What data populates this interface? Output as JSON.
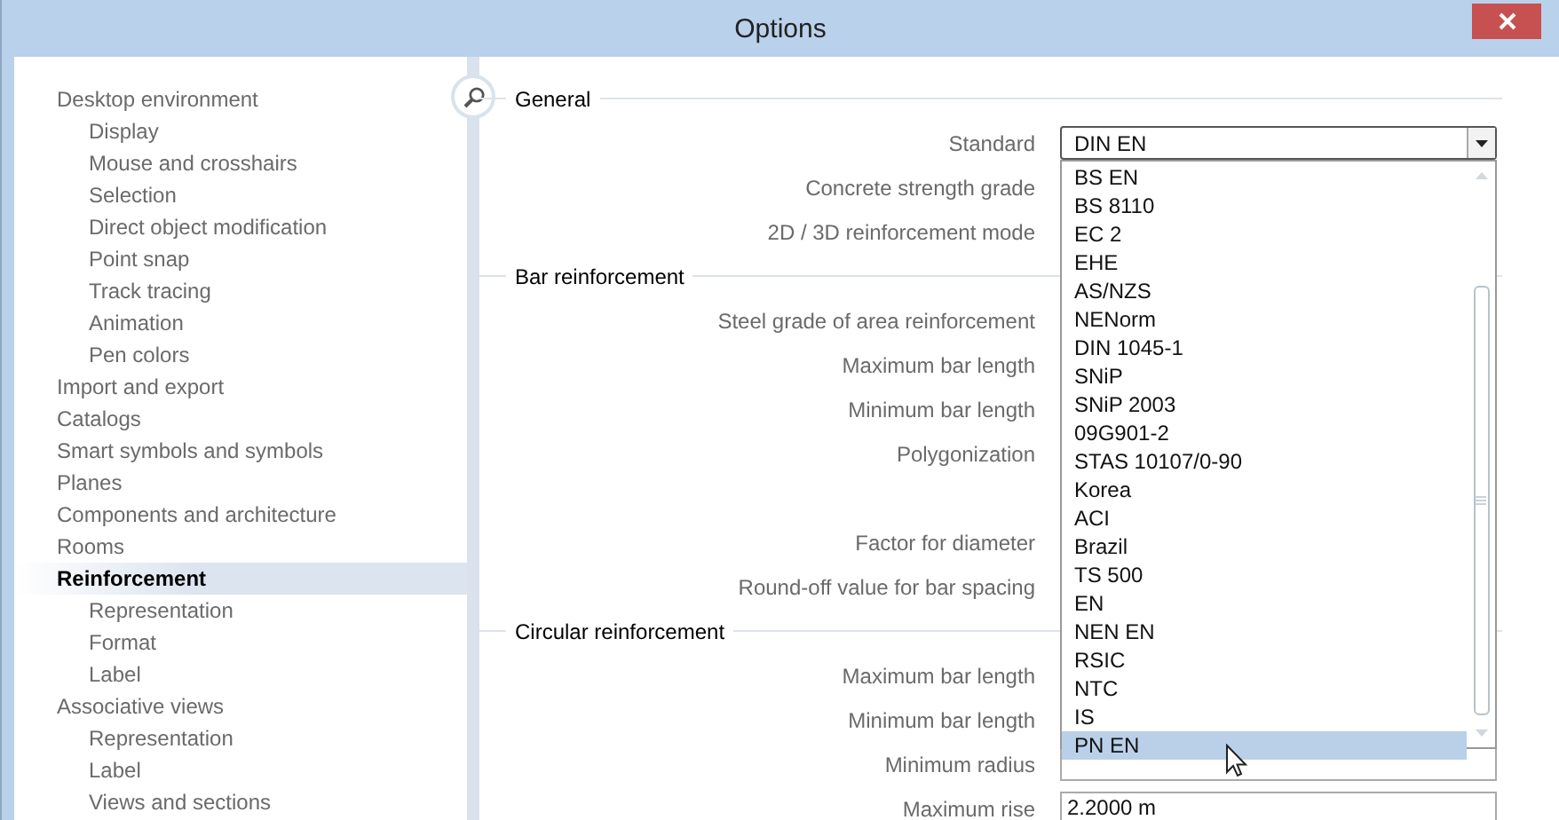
{
  "window": {
    "title": "Options"
  },
  "nav": [
    {
      "label": "Desktop environment",
      "selected": false,
      "children": [
        {
          "label": "Display",
          "selected": false
        },
        {
          "label": "Mouse and crosshairs",
          "selected": false
        },
        {
          "label": "Selection",
          "selected": false
        },
        {
          "label": "Direct object modification",
          "selected": false
        },
        {
          "label": "Point snap",
          "selected": false
        },
        {
          "label": "Track tracing",
          "selected": false
        },
        {
          "label": "Animation",
          "selected": false
        },
        {
          "label": "Pen colors",
          "selected": false
        }
      ]
    },
    {
      "label": "Import and export",
      "selected": false
    },
    {
      "label": "Catalogs",
      "selected": false
    },
    {
      "label": "Smart symbols and symbols",
      "selected": false
    },
    {
      "label": "Planes",
      "selected": false
    },
    {
      "label": "Components and architecture",
      "selected": false
    },
    {
      "label": "Rooms",
      "selected": false
    },
    {
      "label": "Reinforcement",
      "selected": true,
      "children": [
        {
          "label": "Representation",
          "selected": false
        },
        {
          "label": "Format",
          "selected": false
        },
        {
          "label": "Label",
          "selected": false
        }
      ]
    },
    {
      "label": "Associative views",
      "selected": false,
      "children": [
        {
          "label": "Representation",
          "selected": false
        },
        {
          "label": "Label",
          "selected": false
        },
        {
          "label": "Views and sections",
          "selected": false
        }
      ]
    }
  ],
  "sections": [
    {
      "title": "General",
      "rows": [
        {
          "kind": "combo",
          "label": "Standard",
          "value": "DIN EN",
          "expanded": true
        },
        {
          "kind": "plain",
          "label": "Concrete strength grade"
        },
        {
          "kind": "plain",
          "label": "2D / 3D reinforcement mode"
        }
      ]
    },
    {
      "title": "Bar reinforcement",
      "rows": [
        {
          "kind": "plain",
          "label": "Steel grade of area reinforcement"
        },
        {
          "kind": "plain",
          "label": "Maximum bar length"
        },
        {
          "kind": "plain",
          "label": "Minimum bar length"
        },
        {
          "kind": "plain",
          "label": "Polygonization"
        },
        {
          "kind": "blank"
        },
        {
          "kind": "plain",
          "label": "Factor for diameter"
        },
        {
          "kind": "plain",
          "label": "Round-off value for bar spacing"
        }
      ]
    },
    {
      "title": "Circular reinforcement",
      "rows": [
        {
          "kind": "plain",
          "label": "Maximum bar length"
        },
        {
          "kind": "plain",
          "label": "Minimum bar length"
        },
        {
          "kind": "field",
          "label": "Minimum radius"
        },
        {
          "kind": "field",
          "label": "Maximum rise",
          "value": "2.2000 m"
        }
      ]
    }
  ],
  "dropdown": {
    "items": [
      {
        "label": "BS EN",
        "selected": false
      },
      {
        "label": "BS 8110",
        "selected": false
      },
      {
        "label": "EC 2",
        "selected": false
      },
      {
        "label": "EHE",
        "selected": false
      },
      {
        "label": "AS/NZS",
        "selected": false
      },
      {
        "label": "NENorm",
        "selected": false
      },
      {
        "label": "DIN 1045-1",
        "selected": false
      },
      {
        "label": "SNiP",
        "selected": false
      },
      {
        "label": "SNiP 2003",
        "selected": false
      },
      {
        "label": "09G901-2",
        "selected": false
      },
      {
        "label": "STAS 10107/0-90",
        "selected": false
      },
      {
        "label": "Korea",
        "selected": false
      },
      {
        "label": "ACI",
        "selected": false
      },
      {
        "label": "Brazil",
        "selected": false
      },
      {
        "label": "TS 500",
        "selected": false
      },
      {
        "label": "EN",
        "selected": false
      },
      {
        "label": "NEN EN",
        "selected": false
      },
      {
        "label": "RSIC",
        "selected": false
      },
      {
        "label": "NTC",
        "selected": false
      },
      {
        "label": "IS",
        "selected": false
      },
      {
        "label": "PN EN",
        "selected": true
      }
    ]
  }
}
